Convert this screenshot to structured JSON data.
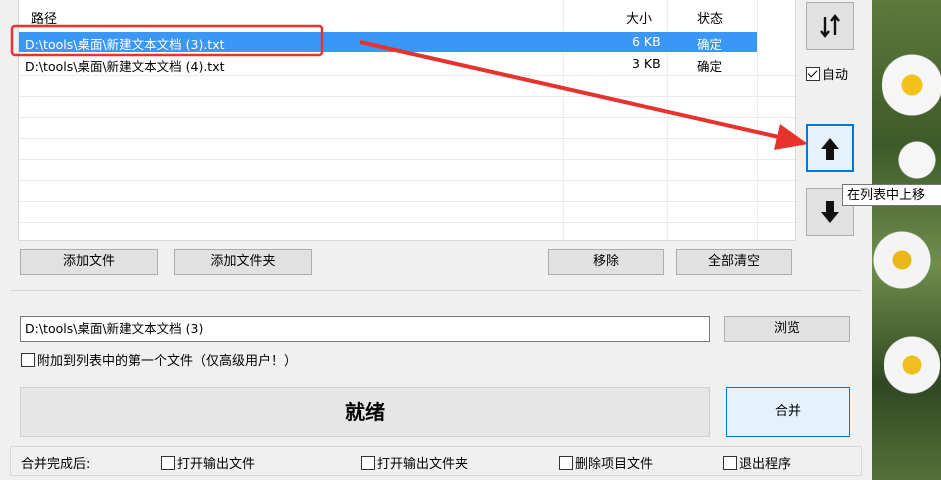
{
  "list": {
    "headers": {
      "path": "路径",
      "size": "大小",
      "status": "状态"
    },
    "rows": [
      {
        "path": "D:\\tools\\桌面\\新建文本文档 (3).txt",
        "size": "6 KB",
        "status": "确定",
        "selected": true
      },
      {
        "path": "D:\\tools\\桌面\\新建文本文档 (4).txt",
        "size": "3 KB",
        "status": "确定",
        "selected": false
      }
    ]
  },
  "buttons": {
    "add_file": "添加文件",
    "add_folder": "添加文件夹",
    "remove": "移除",
    "clear_all": "全部清空",
    "browse": "浏览",
    "merge": "合并"
  },
  "side": {
    "sort_icon": "sort-arrows-icon",
    "auto_label": "自动",
    "auto_checked": true,
    "up_icon": "arrow-up-icon",
    "down_icon": "arrow-down-icon",
    "tooltip": "在列表中上移"
  },
  "output": {
    "path_value": "D:\\tools\\桌面\\新建文本文档 (3)",
    "append_label": "附加到列表中的第一个文件（仅高级用户！）",
    "append_checked": false
  },
  "status_text": "就绪",
  "after_merge": {
    "label": "合并完成后:",
    "options": [
      {
        "label": "打开输出文件",
        "checked": false
      },
      {
        "label": "打开输出文件夹",
        "checked": false
      },
      {
        "label": "删除项目文件",
        "checked": false
      },
      {
        "label": "退出程序",
        "checked": false
      }
    ]
  },
  "colors": {
    "selection": "#3a97f5",
    "annotation_red": "#e8322d",
    "focus_blue": "#0078d7"
  }
}
